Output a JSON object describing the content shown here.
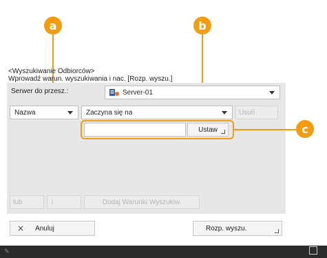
{
  "callouts": {
    "a": "a",
    "b": "b",
    "c": "c"
  },
  "header": {
    "line1": "<Wyszukiwanie Odbiorców>",
    "line2": "Wprowadź warun. wyszukiwania i nac. [Rozp. wyszu.]"
  },
  "server_row": {
    "label": "Serwer do przesz.:",
    "selected": "Server-01",
    "icon": "server-icon"
  },
  "criteria_row": {
    "field_selected": "Nazwa",
    "condition_selected": "Zaczyna się na",
    "delete_label": "Usuń"
  },
  "value_row": {
    "input_value": "",
    "set_label": "Ustaw"
  },
  "logic_row": {
    "or_label": "lub",
    "and_label": "i",
    "add_condition_label": "Dodaj Warunki Wyszukiw."
  },
  "actions": {
    "cancel_label": "Anuluj",
    "start_label": "Rozp. wyszu."
  },
  "colors": {
    "accent": "#f39c12",
    "panel_bg": "#e7e7e7",
    "bar_bg": "#2b2b2b"
  }
}
